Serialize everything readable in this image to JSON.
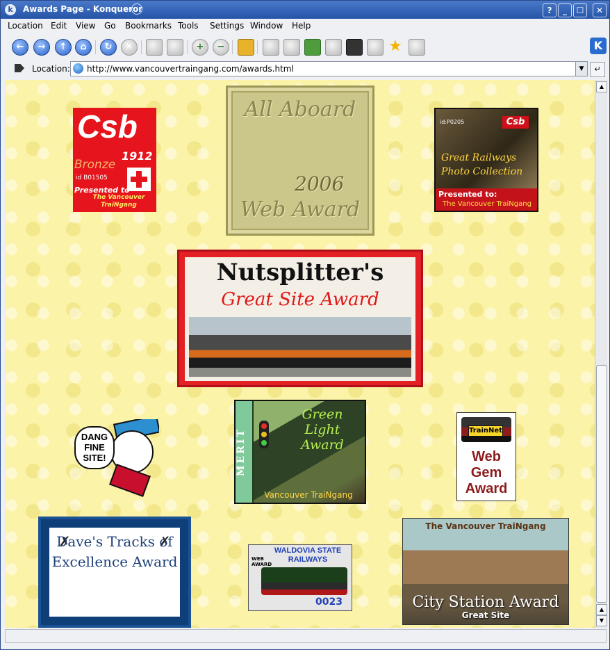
{
  "window": {
    "title": "Awards Page - Konqueror",
    "controls": [
      "?",
      "_",
      "☐",
      "✕"
    ]
  },
  "menu": [
    "Location",
    "Edit",
    "View",
    "Go",
    "Bookmarks",
    "Tools",
    "Settings",
    "Window",
    "Help"
  ],
  "toolbar": {
    "icons": [
      "back-icon",
      "forward-icon",
      "up-icon",
      "home-icon",
      "reload-icon",
      "stop-icon",
      "print-icon",
      "find-icon",
      "zoom-in-icon",
      "zoom-out-icon",
      "security-lock-icon",
      "bookmark-edit-icon",
      "print-frame-icon",
      "upload-icon",
      "edit-icon",
      "terminal-icon",
      "new-window-icon",
      "bookmark-star-icon",
      "view-mode-icon"
    ]
  },
  "location": {
    "label": "Location:",
    "url": "http://www.vancouvertraingang.com/awards.html"
  },
  "awards": {
    "csb_bronze": {
      "logo": "Csb",
      "year": "1912",
      "level": "Bronze",
      "id": "id B01505",
      "presented": "Presented to",
      "recipient": "The Vancouver TraiNgang"
    },
    "all_aboard": {
      "top": "All Aboard",
      "year": "2006",
      "bottom": "Web Award"
    },
    "csb_railways": {
      "tag": "Csb",
      "id": "id:P0205",
      "title": "Great Railways Photo Collection",
      "presented": "Presented to:",
      "recipient": "The Vancouver TraiNgang"
    },
    "nutsplitter": {
      "title": "Nutsplitter's",
      "subtitle": "Great Site Award"
    },
    "dang": {
      "text": "DANG FINE SITE!"
    },
    "green_light": {
      "side": "MERIT",
      "title": "Green Light Award",
      "caption": "Vancouver TraiNgang"
    },
    "trainnet": {
      "badge": "TrainNet",
      "text": "Web Gem Award"
    },
    "daves": {
      "text": "Dave's Tracks of Excellence Award"
    },
    "waldovia": {
      "title": "WALDOVIA STATE RAILWAYS",
      "side": "WEB AWARD",
      "number": "0023"
    },
    "city_station": {
      "top": "The Vancouver TraiNgang",
      "main": "City Station Award",
      "sub": "Great Site"
    }
  },
  "colors": {
    "page_background": "#fbf3a8",
    "titlebar": "#2554a8"
  }
}
